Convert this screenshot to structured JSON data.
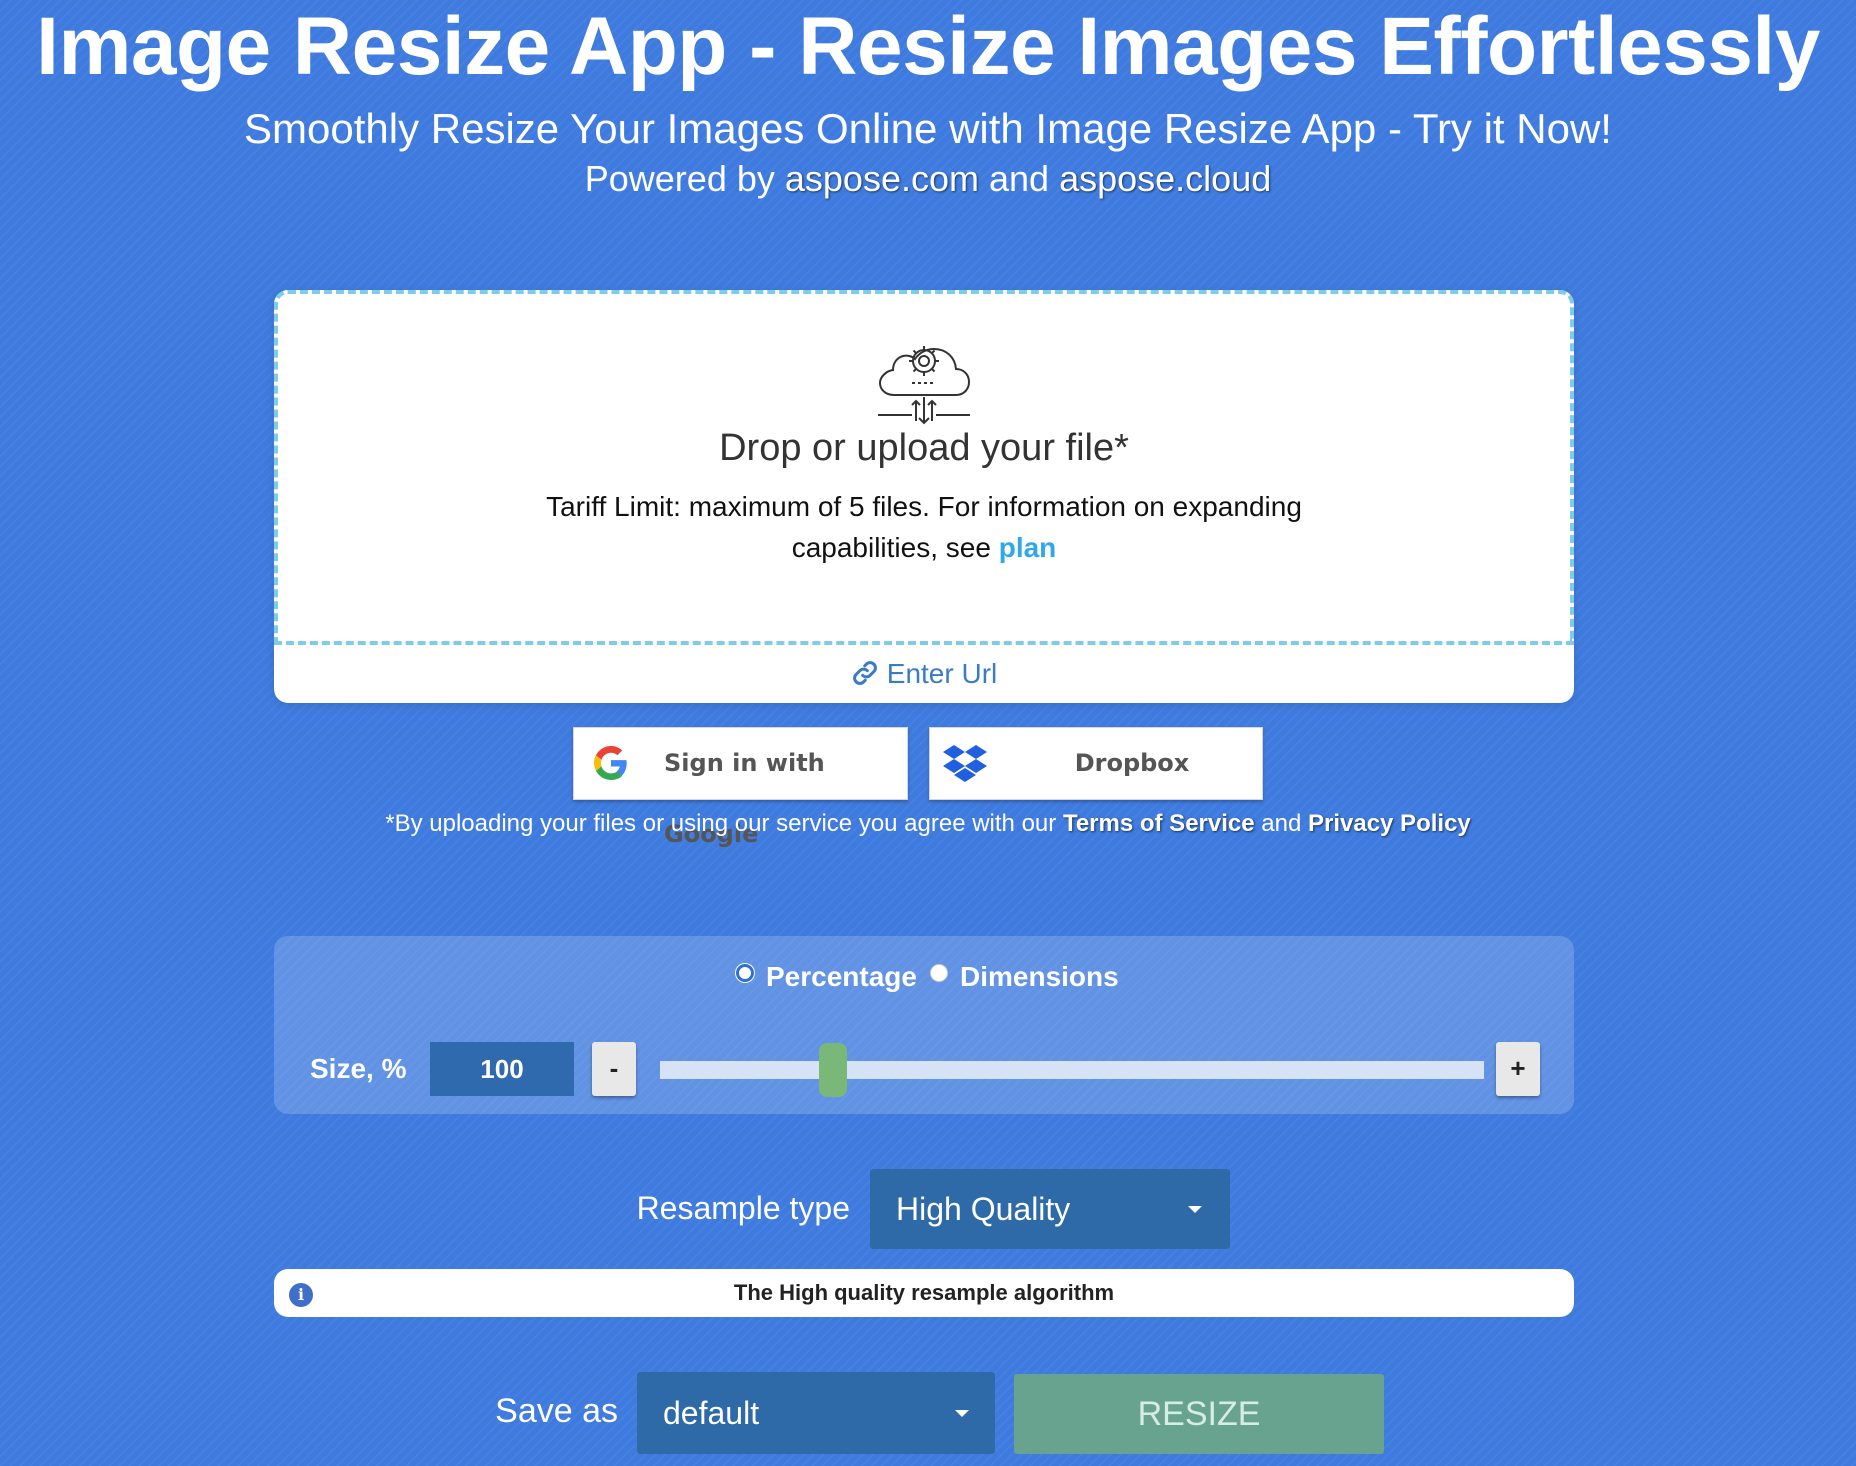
{
  "header": {
    "title": "Image Resize App - Resize Images Effortlessly",
    "subtitle": "Smoothly Resize Your Images Online with Image Resize App - Try it Now!",
    "powered_prefix": "Powered by",
    "powered_link1": "aspose.com",
    "powered_and": "and",
    "powered_link2": "aspose.cloud"
  },
  "upload": {
    "title": "Drop or upload your file*",
    "tariff_text": "Tariff Limit: maximum of 5 files. For information on expanding capabilities, see",
    "plan_link": "plan",
    "enter_url": "Enter Url"
  },
  "cloud_buttons": {
    "google": "Sign in with Google",
    "dropbox": "Dropbox"
  },
  "agreement": {
    "prefix": "*By uploading your files or using our service you agree with our",
    "terms": "Terms of Service",
    "and": "and",
    "privacy": "Privacy Policy"
  },
  "size_panel": {
    "mode_options": [
      "Percentage",
      "Dimensions"
    ],
    "selected_mode": "Percentage",
    "size_label": "Size, %",
    "size_value": "100",
    "minus_label": "-",
    "plus_label": "+",
    "slider_fraction": 0.2
  },
  "resample": {
    "label": "Resample type",
    "selected": "High Quality",
    "info": "The High quality resample algorithm"
  },
  "save": {
    "label": "Save as",
    "selected": "default",
    "resize_button": "RESIZE"
  },
  "colors": {
    "background": "#3f7bdf",
    "link_blue": "#2fa7e8",
    "select_blue": "#2f6aa8",
    "slider_handle": "#7ab87a",
    "resize_button": "#67a38e"
  },
  "icons": {
    "upload": "cloud-gear-upload-icon",
    "url": "link-icon",
    "google": "google-g-icon",
    "dropbox": "dropbox-icon",
    "info": "info-icon",
    "dropdown": "caret-down-icon"
  }
}
